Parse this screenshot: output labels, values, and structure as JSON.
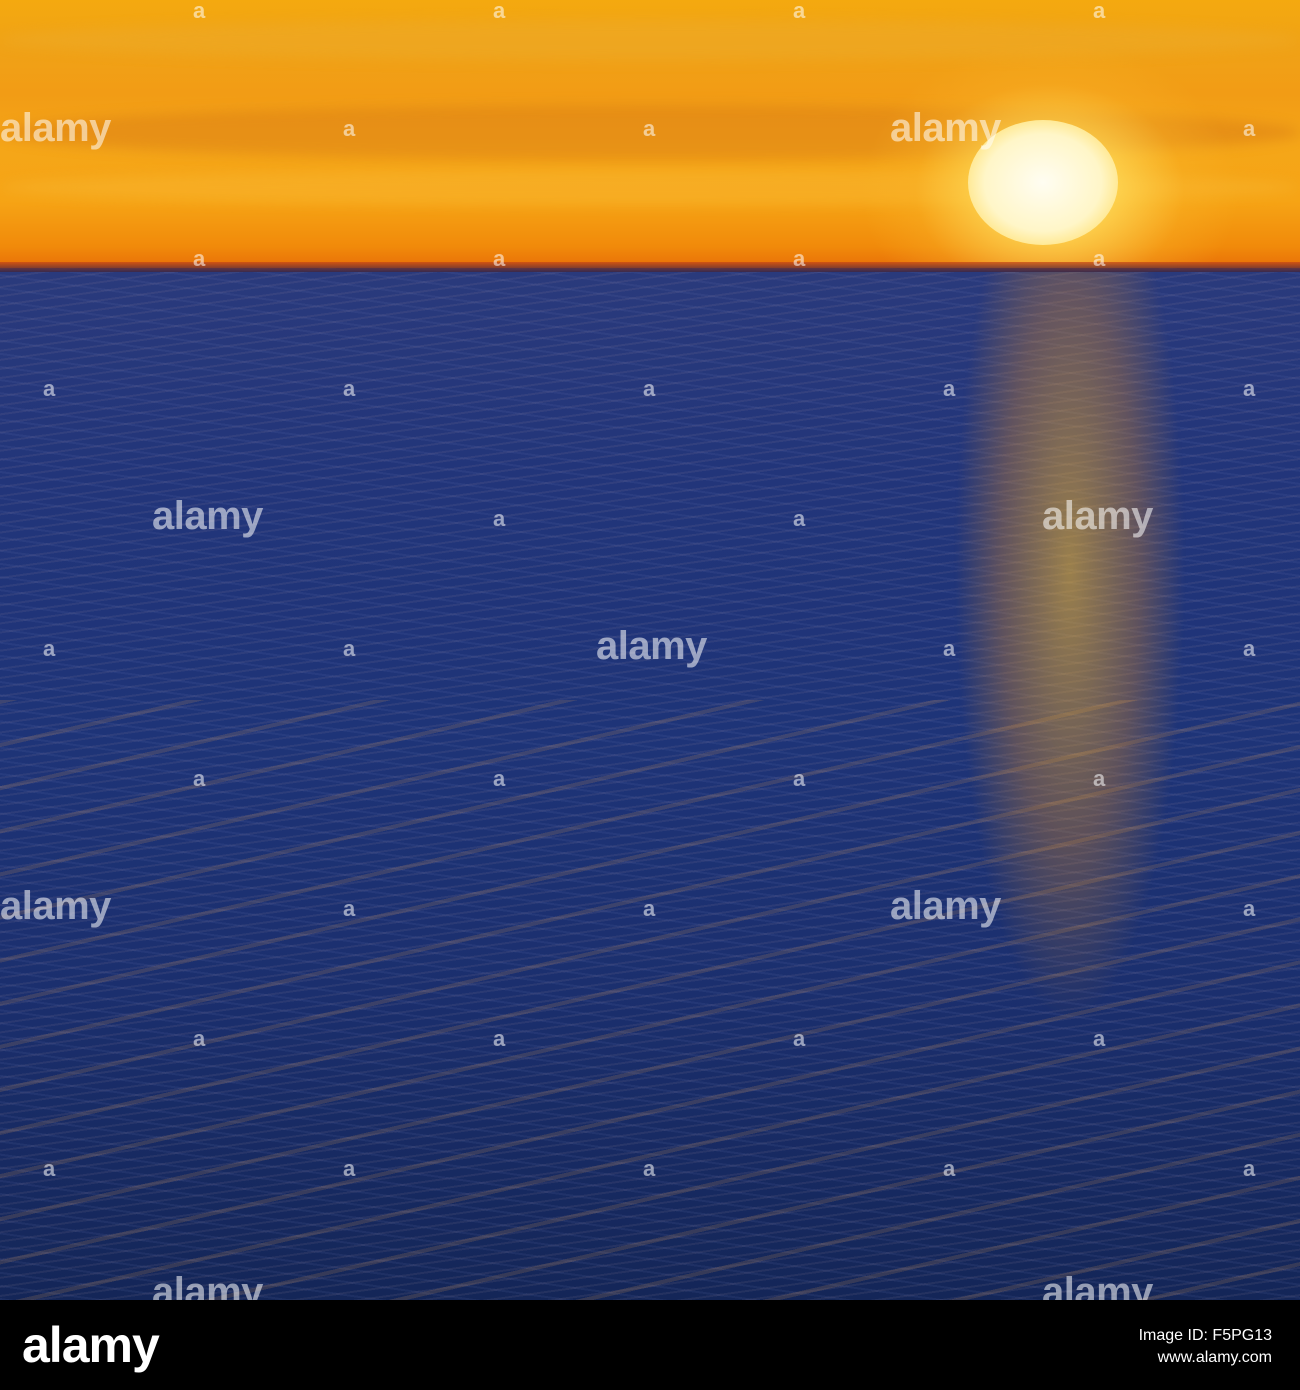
{
  "image": {
    "description_colors": {
      "sky_top": "#f4a90f",
      "sky_horizon": "#e86f08",
      "sun": "#fffdf2",
      "sea_top": "#2a3a7c",
      "sea_bottom": "#142658",
      "footer_bg": "#000000"
    }
  },
  "watermark": {
    "text": "alamy"
  },
  "footer": {
    "logo": "alamy",
    "image_id": "Image ID: F5PG13",
    "url": "www.alamy.com"
  }
}
